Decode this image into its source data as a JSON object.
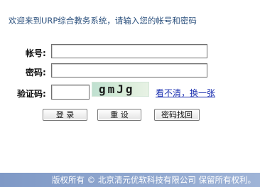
{
  "welcome_text": "欢迎来到URP综合教务系统，请输入您的帐号和密码",
  "form": {
    "account_label": "帐号:",
    "account_value": "",
    "password_label": "密码:",
    "password_value": "",
    "captcha_label": "验证码:",
    "captcha_value": "",
    "captcha_image_text": "gmJg",
    "refresh_link": "看不清，换一张"
  },
  "buttons": {
    "login": "登 录",
    "reset": "重 设",
    "recover": "密码找回"
  },
  "footer": {
    "copyright": "版权所有 © 北京清元优软科技有限公司 保留所有权利。"
  },
  "colors": {
    "footer_bg": "#8ea6cf",
    "link": "#1a2fb0",
    "welcome_text": "#2a4f7c"
  }
}
